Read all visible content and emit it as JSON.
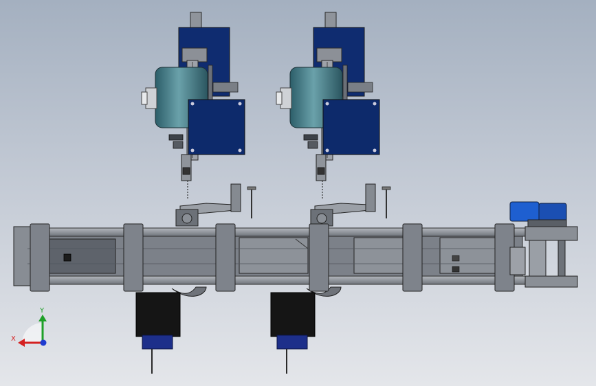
{
  "scene": {
    "subject": "cad-assembly-front-view",
    "station_count": 2,
    "conveyor_segments": 6
  },
  "triad": {
    "x_label": "X",
    "y_label": "Y",
    "x_color": "#d42020",
    "y_color": "#1ea028",
    "z_color": "#1e3cd0"
  },
  "colors": {
    "frame": "#8a8f97",
    "frame_dark": "#4a4f57",
    "clamp": "#7e838b",
    "motor_blue": "#0d2a6b",
    "drum": "#3f7a86",
    "black_box": "#151515",
    "gearmotor": "#1e5fd0"
  }
}
